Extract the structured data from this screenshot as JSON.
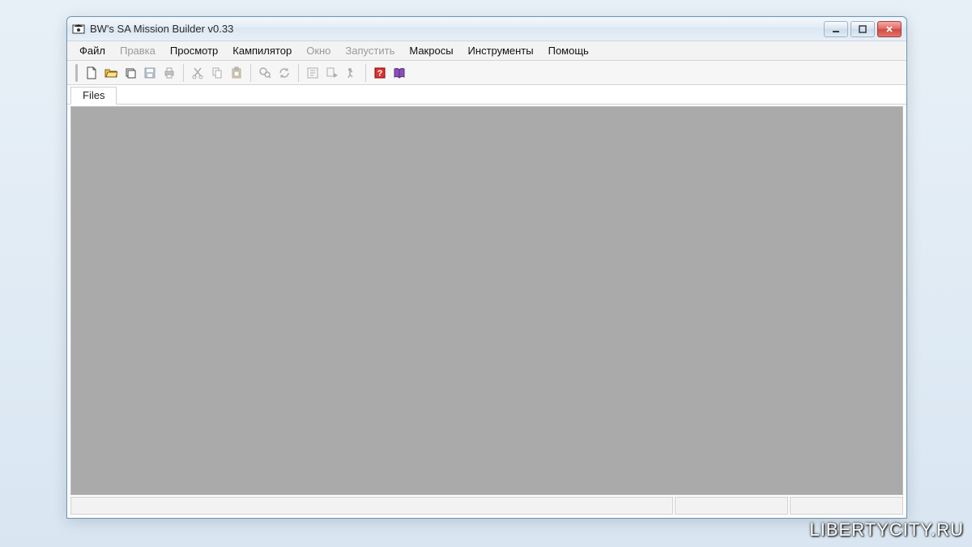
{
  "window": {
    "title": "BW's SA Mission Builder v0.33"
  },
  "menu": {
    "items": [
      {
        "label": "Файл",
        "enabled": true
      },
      {
        "label": "Правка",
        "enabled": false
      },
      {
        "label": "Просмотр",
        "enabled": true
      },
      {
        "label": "Кампилятор",
        "enabled": true
      },
      {
        "label": "Окно",
        "enabled": false
      },
      {
        "label": "Запустить",
        "enabled": false
      },
      {
        "label": "Макросы",
        "enabled": true
      },
      {
        "label": "Инструменты",
        "enabled": true
      },
      {
        "label": "Помощь",
        "enabled": true
      }
    ]
  },
  "toolbar": {
    "groups": [
      [
        {
          "name": "new-file-icon",
          "enabled": true
        },
        {
          "name": "open-file-icon",
          "enabled": true
        },
        {
          "name": "open-multi-icon",
          "enabled": true
        },
        {
          "name": "save-icon",
          "enabled": false
        },
        {
          "name": "print-icon",
          "enabled": false
        }
      ],
      [
        {
          "name": "cut-icon",
          "enabled": false
        },
        {
          "name": "copy-icon",
          "enabled": false
        },
        {
          "name": "paste-icon",
          "enabled": false
        }
      ],
      [
        {
          "name": "find-icon",
          "enabled": false
        },
        {
          "name": "refresh-icon",
          "enabled": false
        }
      ],
      [
        {
          "name": "compile-icon",
          "enabled": false
        },
        {
          "name": "compile-run-icon",
          "enabled": false
        },
        {
          "name": "run-icon",
          "enabled": false
        }
      ],
      [
        {
          "name": "help-icon",
          "enabled": true
        },
        {
          "name": "book-icon",
          "enabled": true
        }
      ]
    ]
  },
  "tabs": {
    "items": [
      {
        "label": "Files"
      }
    ]
  },
  "watermark": "LIBERTYCITY.RU"
}
